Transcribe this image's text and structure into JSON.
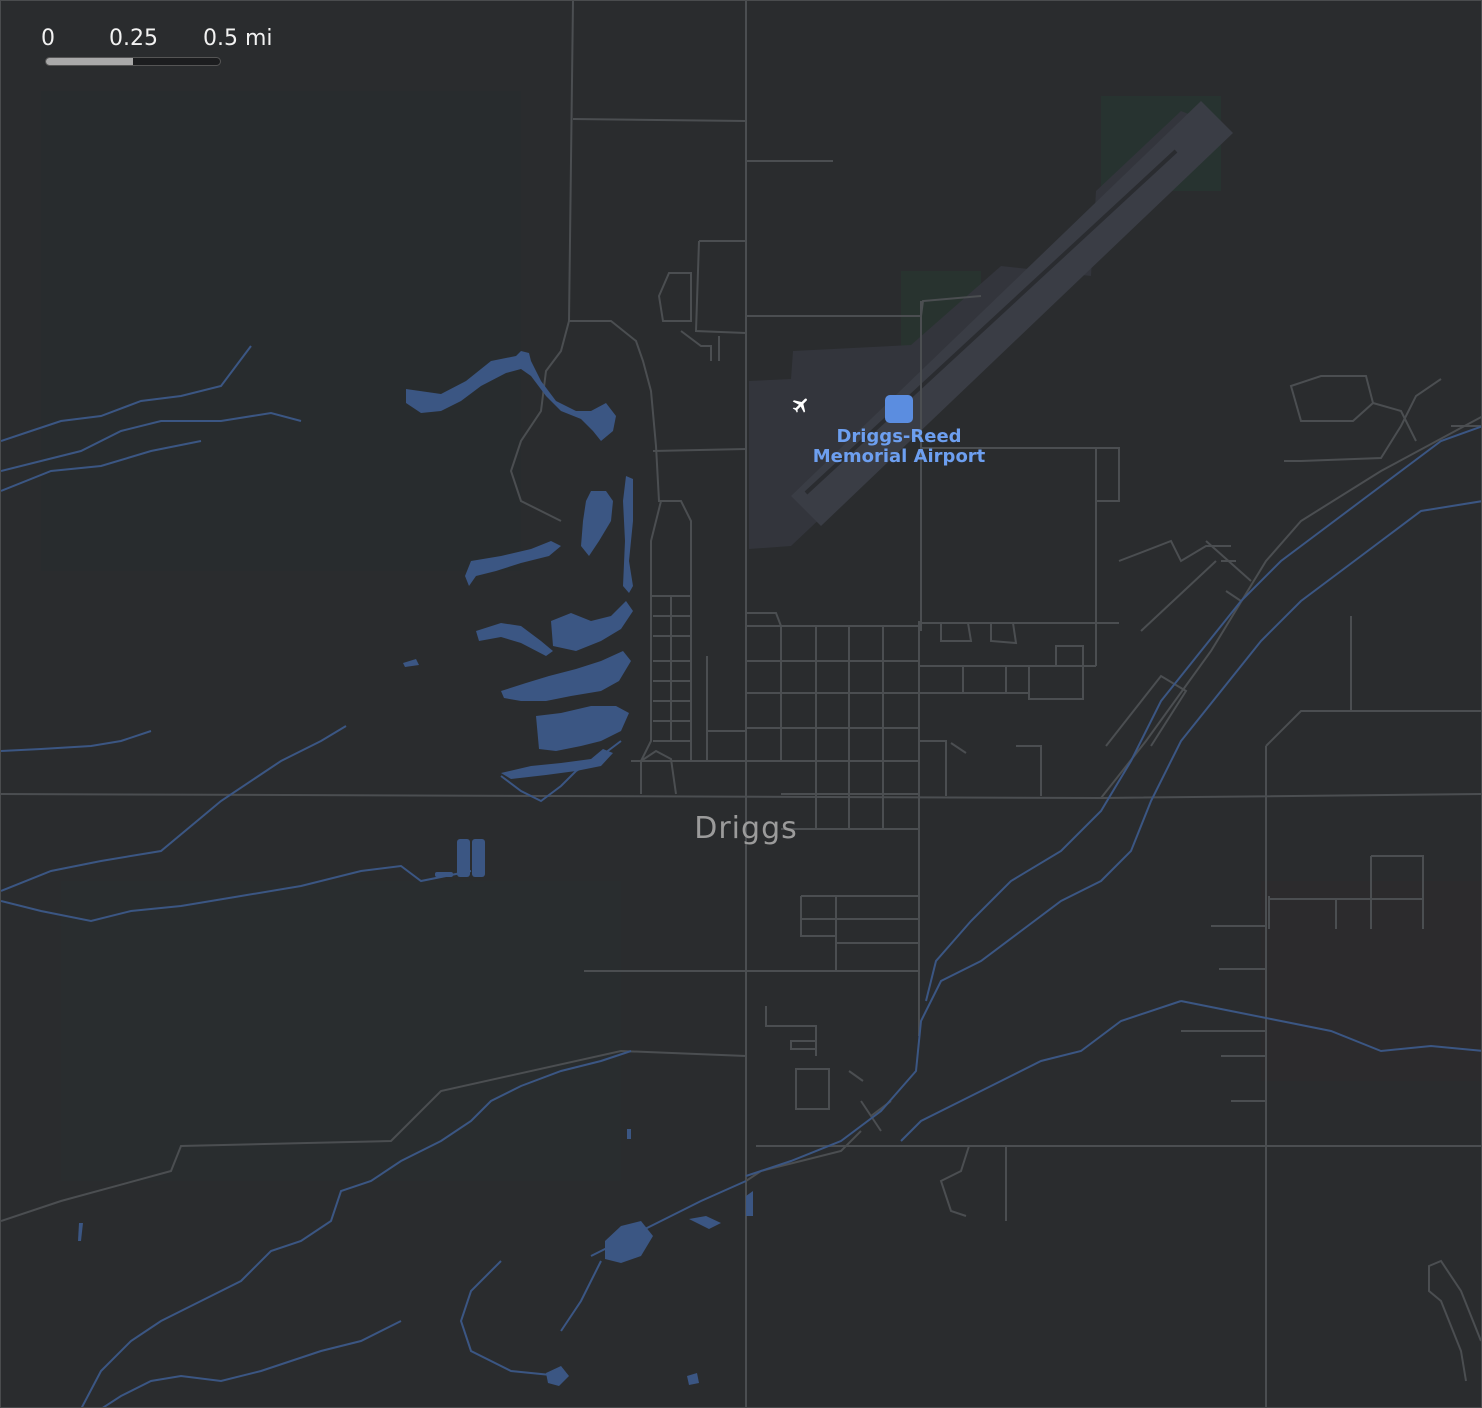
{
  "scale": {
    "ticks": [
      "0",
      "0.25",
      "0.5 mi"
    ],
    "fill_fraction": 0.5
  },
  "city": {
    "name": "Driggs"
  },
  "poi": {
    "name_line1": "Driggs-Reed",
    "name_line2": "Memorial Airport",
    "icon": "airplane-icon"
  },
  "colors": {
    "background": "#2a2c2e",
    "road": "#4b4e51",
    "water": "#3b5683",
    "airport_area": "#34363c",
    "poi": "#5b8de0",
    "label": "#9b9b9b"
  }
}
